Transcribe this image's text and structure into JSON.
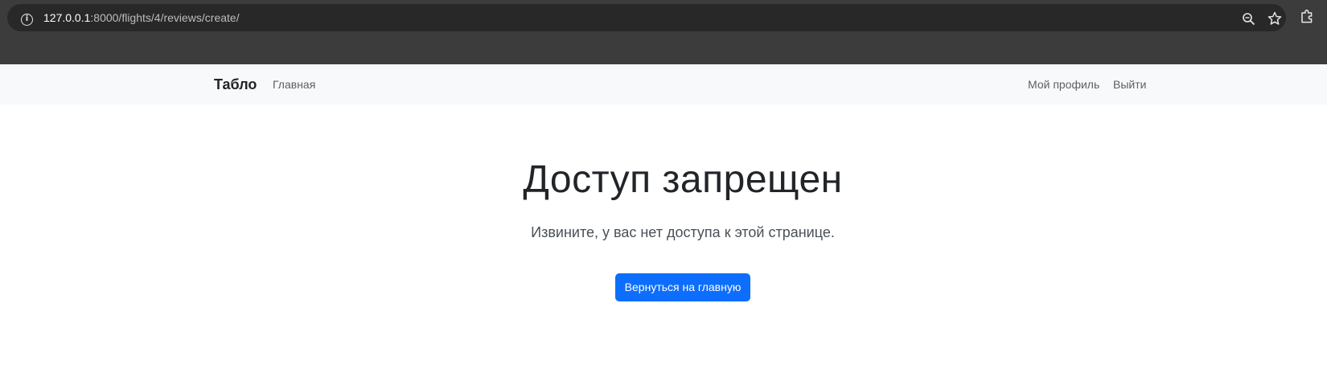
{
  "browser": {
    "url_host": "127.0.0.1",
    "url_path": ":8000/flights/4/reviews/create/",
    "icons": [
      "info-icon",
      "zoom-icon",
      "star-icon",
      "extensions-icon"
    ]
  },
  "navbar": {
    "brand": "Табло",
    "home": "Главная",
    "profile": "Мой профиль",
    "logout": "Выйти"
  },
  "main": {
    "title": "Доступ запрещен",
    "message": "Извините, у вас нет доступа к этой странице.",
    "button_label": "Вернуться на главную"
  },
  "colors": {
    "primary": "#0d6efd",
    "navbar_bg": "#f8f9fa",
    "chrome_bg": "#3c3c3c",
    "addressbar_bg": "#282828"
  }
}
